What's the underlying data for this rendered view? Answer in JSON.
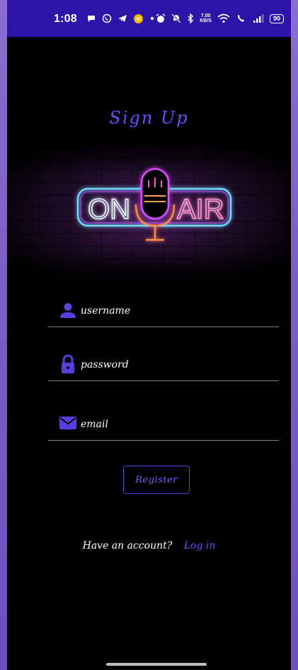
{
  "status_bar": {
    "time": "1:08",
    "network_speed_value": "7.00",
    "network_speed_unit": "KB/S",
    "battery": "90"
  },
  "screen": {
    "title": "Sign Up",
    "banner_left_text": "ON",
    "banner_right_text": "AIR"
  },
  "form": {
    "username_placeholder": "username",
    "password_placeholder": "password",
    "email_placeholder": "email",
    "username_value": "",
    "password_value": "",
    "email_value": "",
    "register_label": "Register"
  },
  "footer": {
    "prompt": "Have an account?",
    "login_label": "Log in"
  },
  "colors": {
    "accent": "#6c4dff",
    "status_bar": "#2e13a8",
    "background": "#000000",
    "neon_blue": "#6fd8ff",
    "neon_pink": "#d84dff",
    "neon_orange": "#ff8a4d"
  },
  "icons": {
    "username": "person-icon",
    "password": "lock-icon",
    "email": "mail-icon"
  }
}
